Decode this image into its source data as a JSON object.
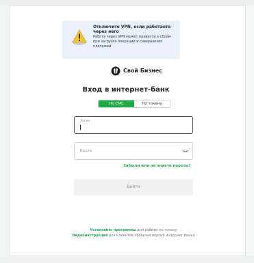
{
  "vpn_notice": {
    "icon": "warning-icon",
    "title": "Отключите VPN, если работаете через него",
    "text": "Работа через VPN может привести к сбоям при загрузке операций и совершении платежей"
  },
  "brand": {
    "logo_icon": "svoy-biznes-logo",
    "name": "Свой Бизнес"
  },
  "page": {
    "heading": "Вход в интернет-банк"
  },
  "auth_tabs": [
    {
      "label": "По СМС",
      "active": true
    },
    {
      "label": "По токену",
      "active": false
    }
  ],
  "form": {
    "login_label": "Логин",
    "login_value": "",
    "password_label": "Пароль",
    "password_value": "",
    "forgot_link": "Забыли или не знаете пароль?",
    "submit_label": "Войти"
  },
  "footer": {
    "install_link": "Установить программы",
    "install_text": " для работы по токену",
    "video_link": "Видеоинструкция",
    "video_text": " для клиентов прошлых версий интернет-банка"
  },
  "colors": {
    "accent": "#23a84a",
    "notice_bg": "#eaf1fb"
  }
}
